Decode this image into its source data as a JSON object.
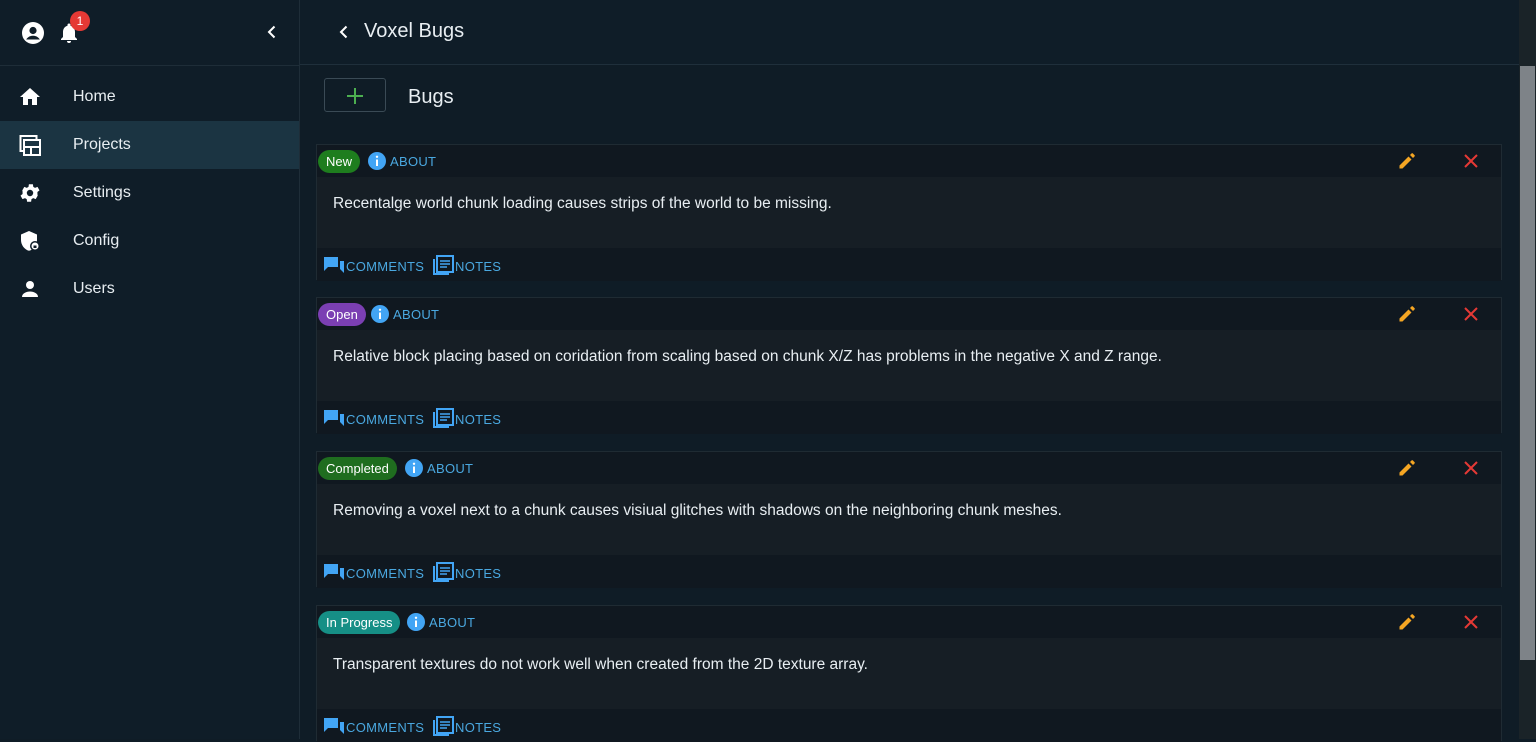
{
  "sidebar": {
    "notification_count": "1",
    "items": [
      {
        "label": "Home",
        "icon": "home-icon"
      },
      {
        "label": "Projects",
        "icon": "projects-icon",
        "active": true
      },
      {
        "label": "Settings",
        "icon": "gear-icon"
      },
      {
        "label": "Config",
        "icon": "shield-lock-icon"
      },
      {
        "label": "Users",
        "icon": "user-icon"
      }
    ]
  },
  "header": {
    "title": "Voxel Bugs"
  },
  "main": {
    "section_title": "Bugs",
    "about_label": "ABOUT",
    "comments_label": "COMMENTS",
    "notes_label": "NOTES",
    "bugs": [
      {
        "status": "New",
        "status_color": "#1e7d1e",
        "text": "Recentalge world chunk loading causes strips of the world to be missing."
      },
      {
        "status": "Open",
        "status_color": "#7b3fb3",
        "text": "Relative block placing based on coridation from scaling based on chunk X/Z has problems in the negative X and Z range."
      },
      {
        "status": "Completed",
        "status_color": "#1f6d1f",
        "text": "Removing a voxel next to a chunk causes visiual glitches with shadows on the neighboring chunk meshes."
      },
      {
        "status": "In Progress",
        "status_color": "#168f86",
        "text": "Transparent textures do not work well when created from the 2D texture array."
      }
    ]
  },
  "colors": {
    "accent_link": "#4aa8e0",
    "edit_icon": "#f5a623",
    "delete_icon": "#e53935",
    "add_icon": "#4caf50"
  }
}
